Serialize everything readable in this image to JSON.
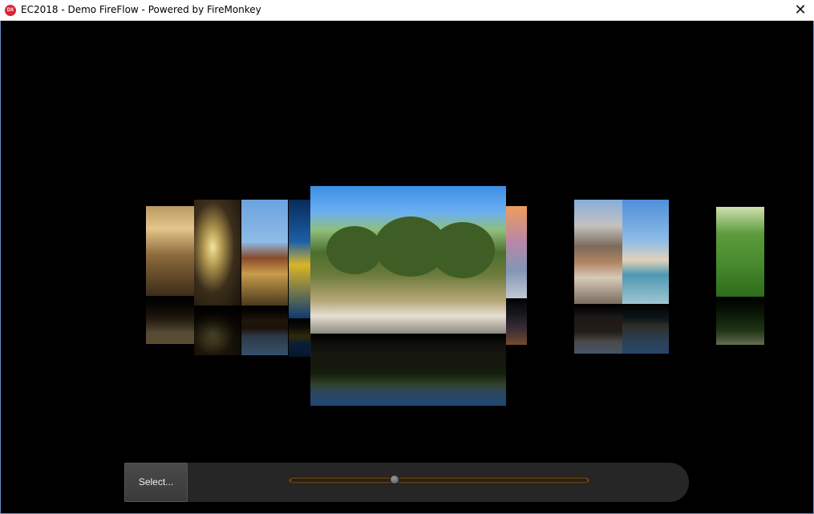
{
  "window": {
    "title": "EC2018 - Demo FireFlow - Powered by FireMonkey",
    "app_icon_text": "DX",
    "close_glyph": "✕"
  },
  "gallery": {
    "covers": [
      {
        "name": "cover-golden-shore"
      },
      {
        "name": "cover-glowing-flower"
      },
      {
        "name": "cover-building-reef"
      },
      {
        "name": "cover-blue-yellow-toy"
      },
      {
        "name": "cover-eucalyptus-beach"
      },
      {
        "name": "cover-sunset"
      },
      {
        "name": "cover-seaside-houses"
      },
      {
        "name": "cover-beach-bay"
      },
      {
        "name": "cover-child-football"
      }
    ],
    "selected_index": 4
  },
  "controls": {
    "select_label": "Select...",
    "slider_value": 0.35
  },
  "colors": {
    "background": "#000000",
    "slider_track": "#7a5526",
    "title_bar": "#ffffff"
  }
}
